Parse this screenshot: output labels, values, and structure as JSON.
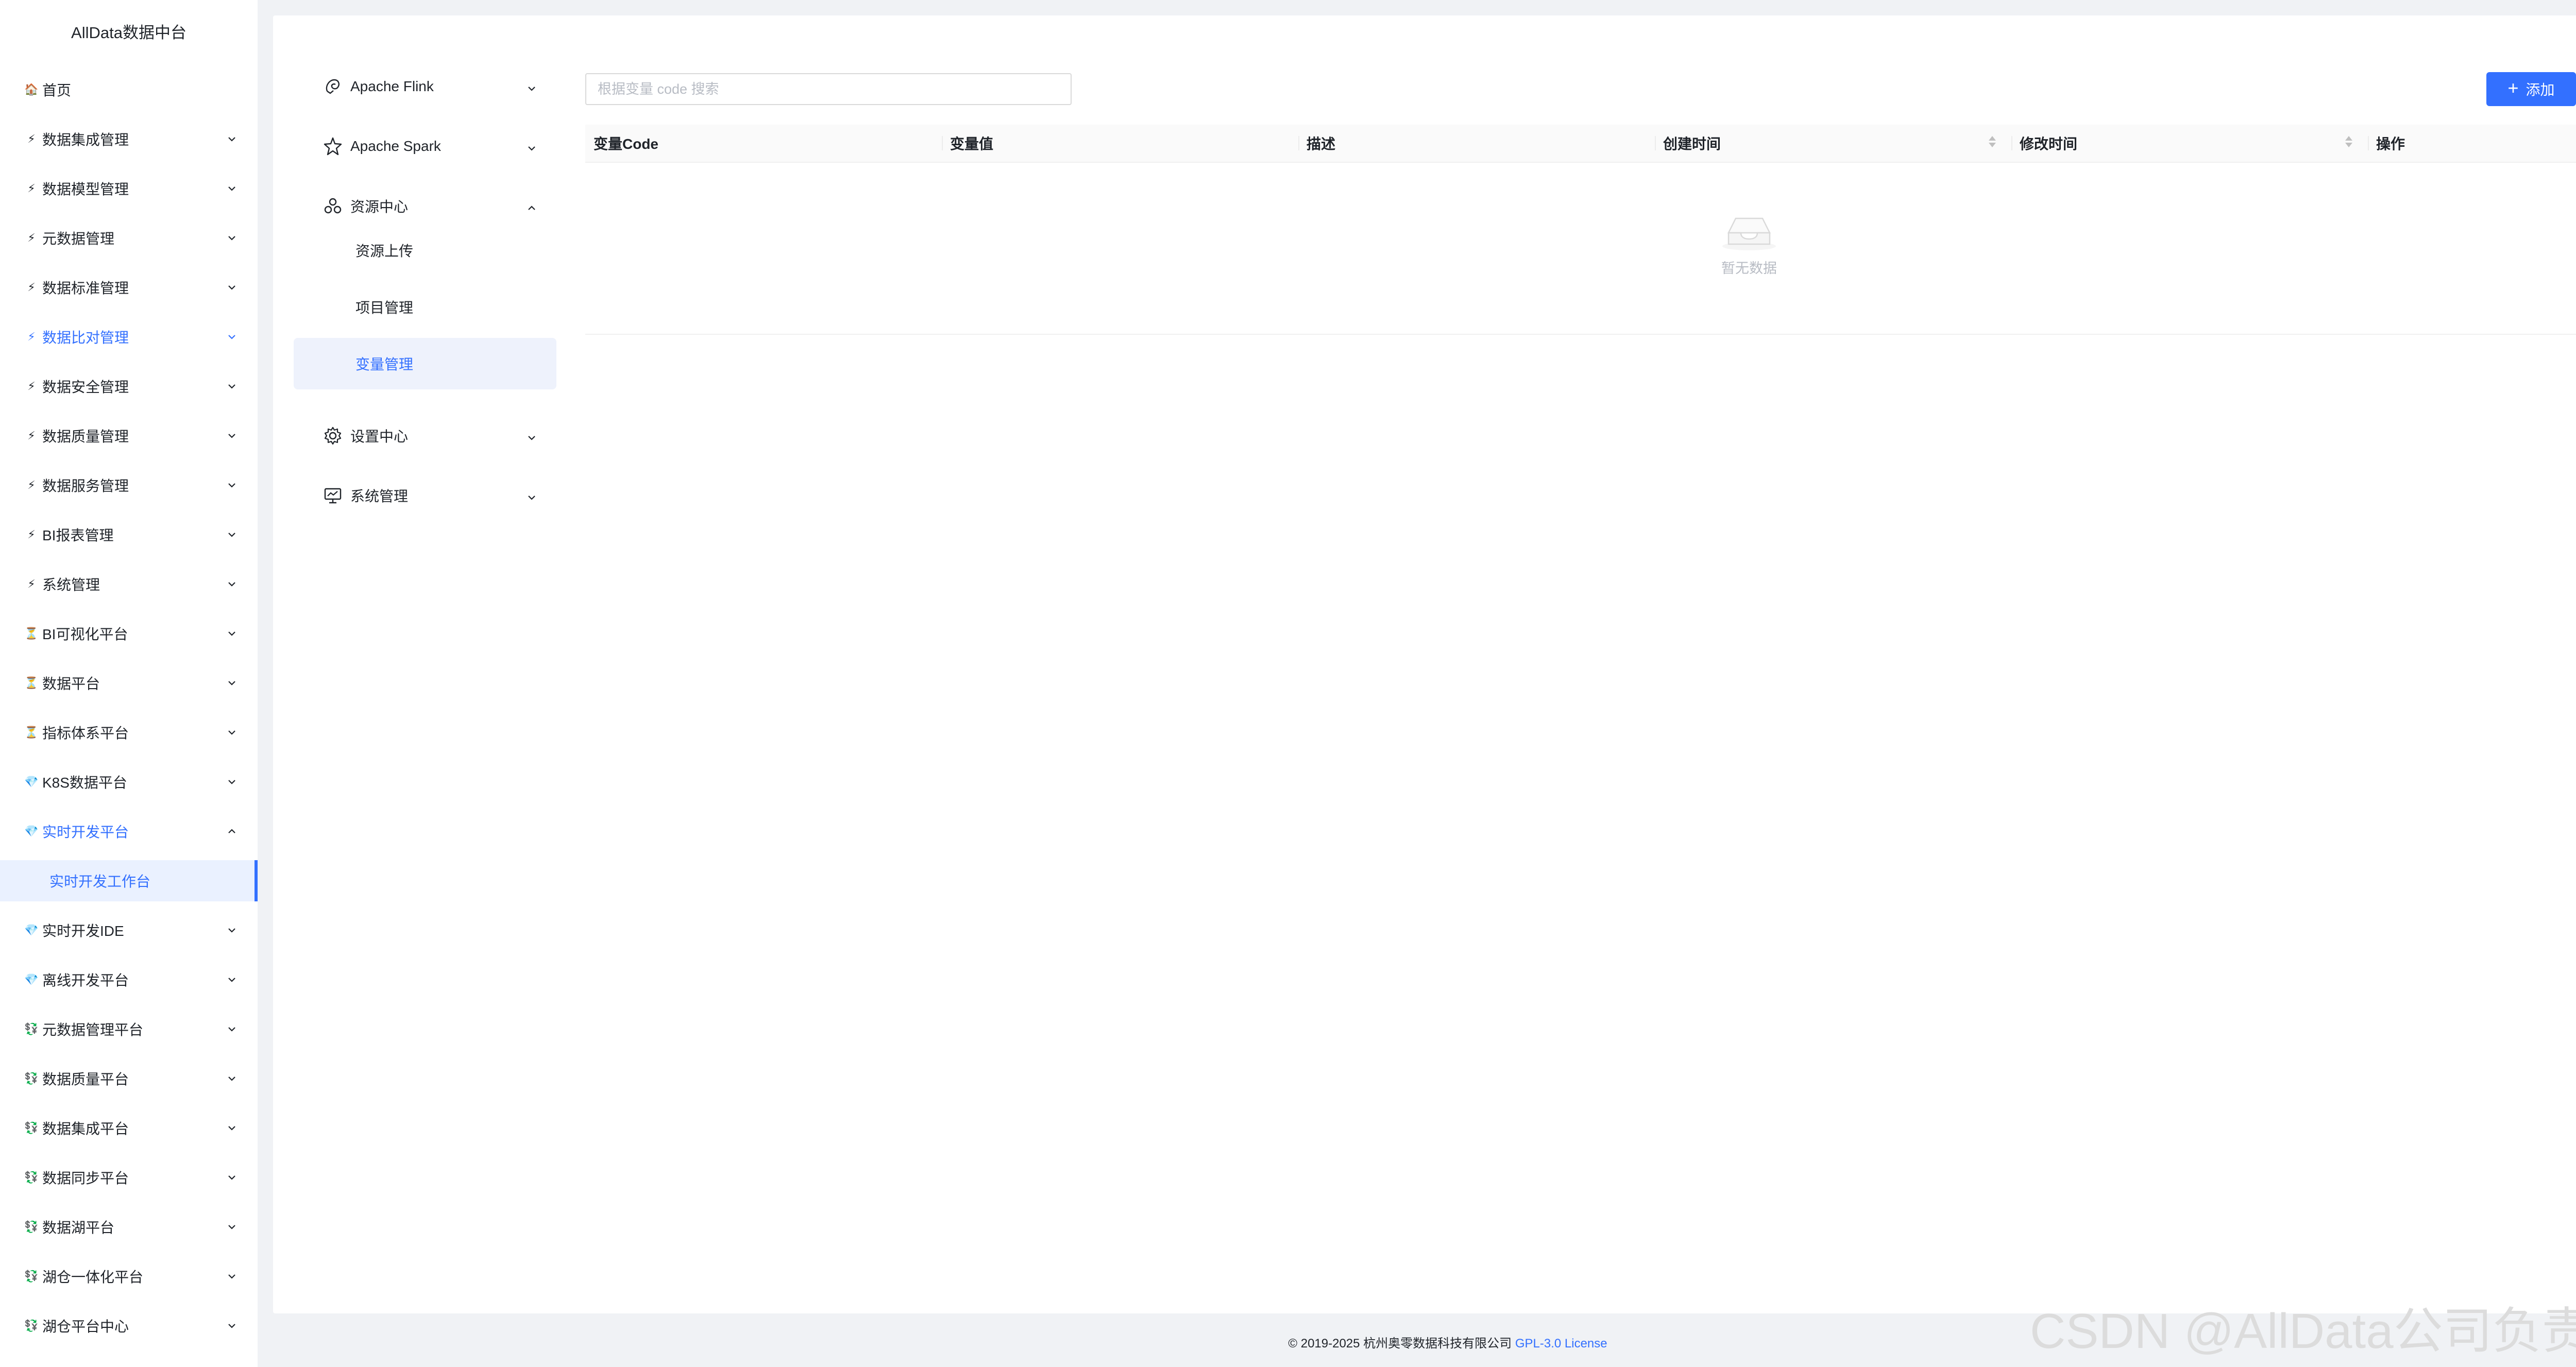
{
  "app": {
    "title": "AllData数据中台"
  },
  "sidebar": {
    "items": [
      {
        "label": "首页",
        "icon": "🏠"
      },
      {
        "label": "数据集成管理",
        "icon": "⚡"
      },
      {
        "label": "数据模型管理",
        "icon": "⚡"
      },
      {
        "label": "元数据管理",
        "icon": "⚡"
      },
      {
        "label": "数据标准管理",
        "icon": "⚡"
      },
      {
        "label": "数据比对管理",
        "icon": "⚡"
      },
      {
        "label": "数据安全管理",
        "icon": "⚡"
      },
      {
        "label": "数据质量管理",
        "icon": "⚡"
      },
      {
        "label": "数据服务管理",
        "icon": "⚡"
      },
      {
        "label": "BI报表管理",
        "icon": "⚡"
      },
      {
        "label": "系统管理",
        "icon": "⚡"
      },
      {
        "label": "BI可视化平台",
        "icon": "⏳"
      },
      {
        "label": "数据平台",
        "icon": "⏳"
      },
      {
        "label": "指标体系平台",
        "icon": "⏳"
      },
      {
        "label": "K8S数据平台",
        "icon": "💎"
      },
      {
        "label": "实时开发平台",
        "icon": "💎"
      },
      {
        "label": "实时开发IDE",
        "icon": "💎"
      },
      {
        "label": "离线开发平台",
        "icon": "💎"
      },
      {
        "label": "元数据管理平台",
        "icon": "💱"
      },
      {
        "label": "数据质量平台",
        "icon": "💱"
      },
      {
        "label": "数据集成平台",
        "icon": "💱"
      },
      {
        "label": "数据同步平台",
        "icon": "💱"
      },
      {
        "label": "数据湖平台",
        "icon": "💱"
      },
      {
        "label": "湖仓一体化平台",
        "icon": "💱"
      },
      {
        "label": "湖仓平台中心",
        "icon": "💱"
      }
    ],
    "active_child": "实时开发工作台",
    "accent_color": "#3370ff"
  },
  "submenu": {
    "items": [
      {
        "label": "Apache Flink",
        "icon": "flink-icon"
      },
      {
        "label": "Apache Spark",
        "icon": "spark-icon"
      },
      {
        "label": "资源中心",
        "icon": "resource-center-icon"
      },
      {
        "label": "设置中心",
        "icon": "settings-icon"
      },
      {
        "label": "系统管理",
        "icon": "monitor-icon"
      }
    ],
    "children": [
      {
        "label": "资源上传"
      },
      {
        "label": "项目管理"
      },
      {
        "label": "变量管理"
      }
    ]
  },
  "toolbar": {
    "search_placeholder": "根据变量 code 搜索",
    "add_label": "添加"
  },
  "table": {
    "columns": [
      "变量Code",
      "变量值",
      "描述",
      "创建时间",
      "修改时间",
      "操作"
    ],
    "empty_text": "暂无数据"
  },
  "footer": {
    "copyright": "© 2019-2025 杭州奥零数据科技有限公司",
    "license": "GPL-3.0 License"
  },
  "watermark": "CSDN @AllData公司负责人"
}
